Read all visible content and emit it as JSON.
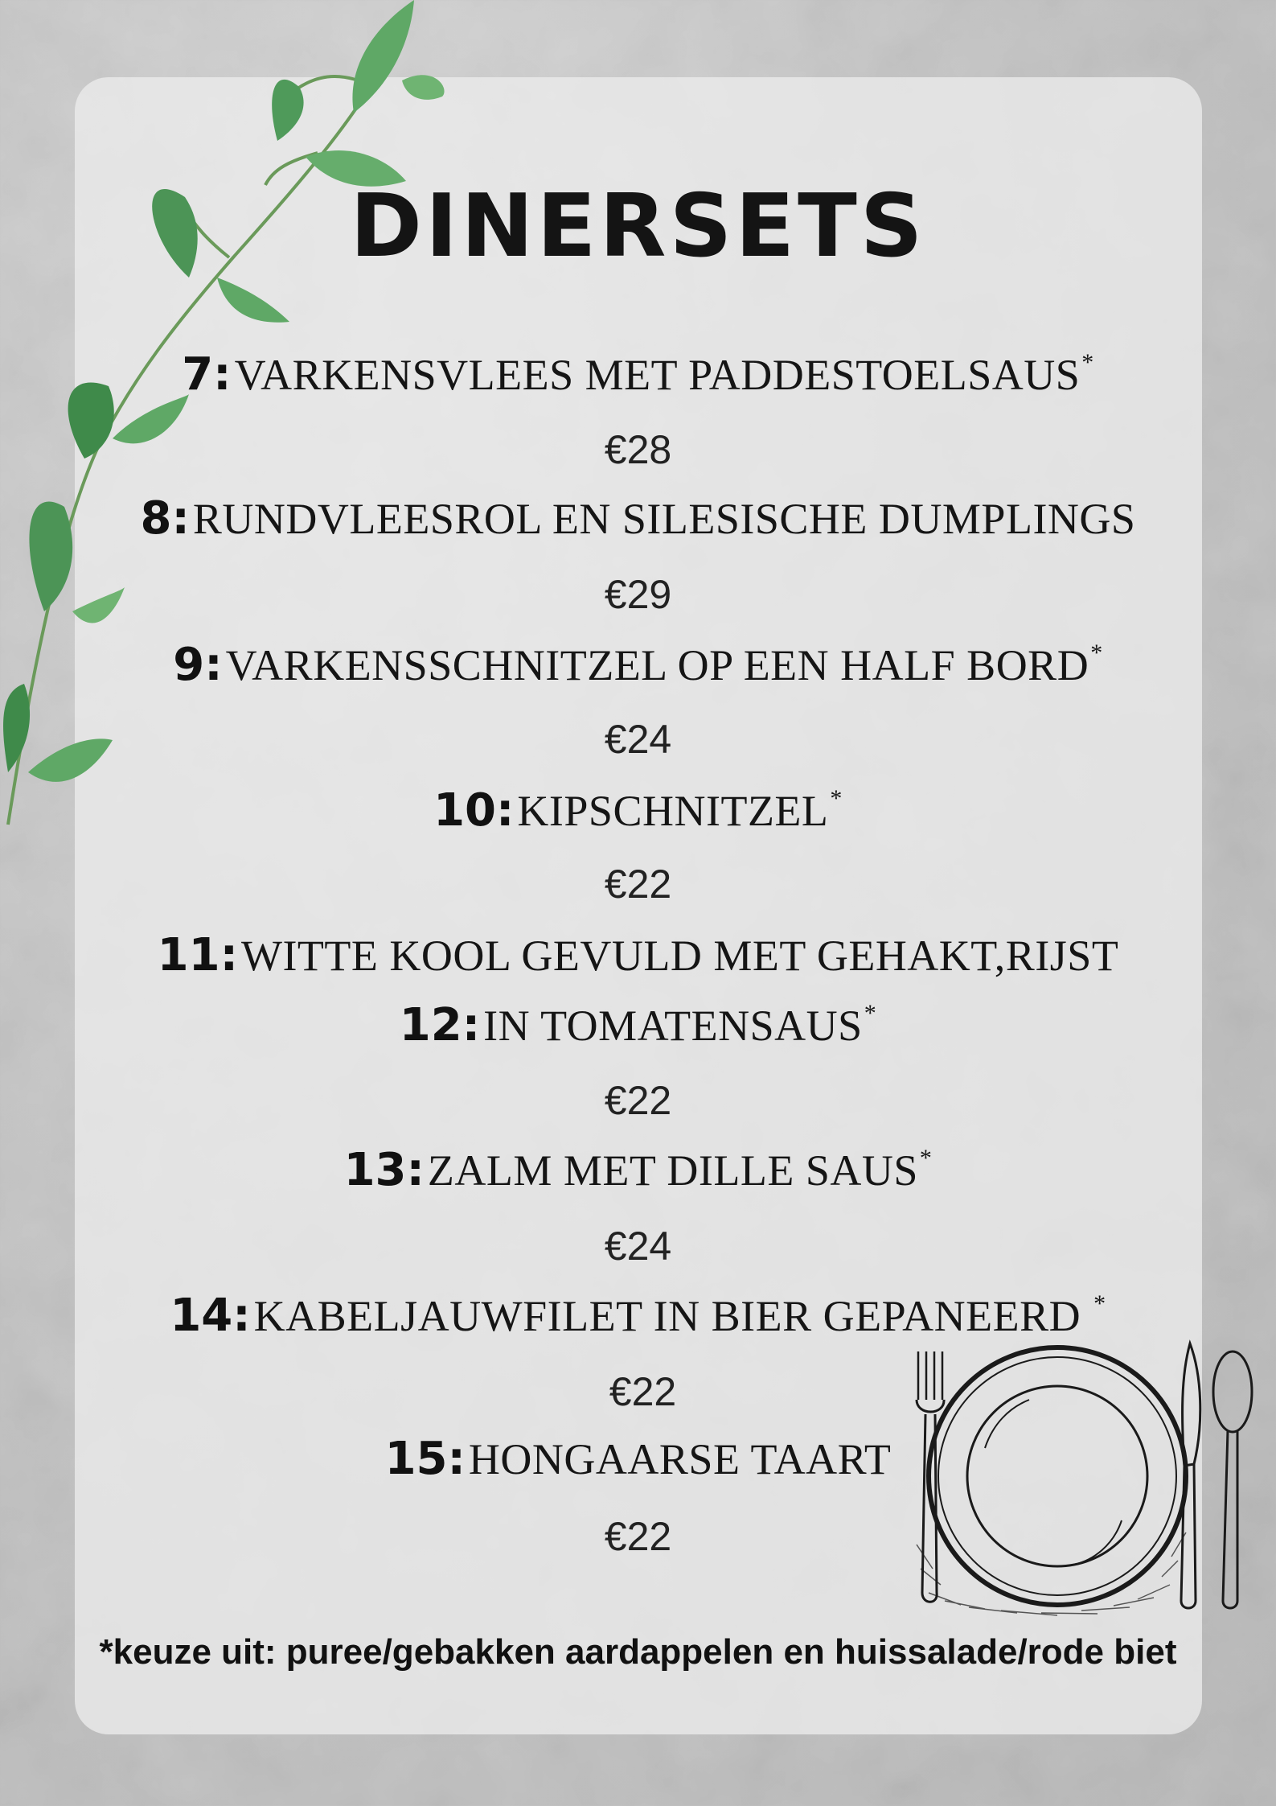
{
  "title": "DINERSETS",
  "items": [
    {
      "number": "7:",
      "name": "Varkensvlees met paddestoelsaus",
      "marker": "*",
      "price": "€28"
    },
    {
      "number": "8:",
      "name": "Rundvleesrol en Silesische dumplings",
      "marker": "",
      "price": "€29"
    },
    {
      "number": "9:",
      "name": "Varkensschnitzel op een half bord",
      "marker": "*",
      "price": "€24"
    },
    {
      "number": "10:",
      "name": "Kipschnitzel",
      "marker": "*",
      "price": "€22"
    },
    {
      "number": "11:",
      "name": "Witte kool gevuld met gehakt,rijst",
      "marker": "",
      "price": ""
    },
    {
      "number": "12:",
      "name": "in tomatensaus",
      "marker": "*",
      "price": "€22"
    },
    {
      "number": "13:",
      "name": "Zalm met dille saus",
      "marker": "*",
      "price": "€24"
    },
    {
      "number": "14:",
      "name": "Kabeljauwfilet in bier gepaneerd ",
      "marker": "*",
      "price": "€22"
    },
    {
      "number": "15:",
      "name": "Hongaarse taart",
      "marker": "",
      "price": "€22"
    }
  ],
  "footnote": "*keuze uit: puree/gebakken aardappelen en huissalade/rode biet",
  "decor": {
    "leaf_icon": "vine-leaves",
    "plate_icon": "plate-fork-knife-spoon",
    "leaf_color": "#5fa866",
    "leaf_dark": "#2f7a3c"
  }
}
